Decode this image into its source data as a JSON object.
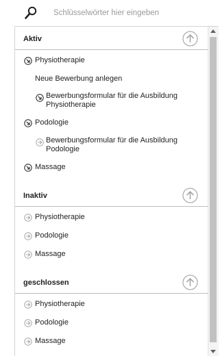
{
  "search": {
    "placeholder": "Schlüsselwörter hier eingeben"
  },
  "sections": {
    "aktiv": {
      "title": "Aktiv",
      "physio": "Physiotherapie",
      "neue_bewerbung": "Neue Bewerbung anlegen",
      "form_physio": "Bewerbungsformular für die Ausbildung Physiotherapie",
      "podo": "Podologie",
      "form_podo": "Bewerbungsformular für die Ausbildung Podologie",
      "massage": "Massage"
    },
    "inaktiv": {
      "title": "Inaktiv",
      "physio": "Physiotherapie",
      "podo": "Podologie",
      "massage": "Massage"
    },
    "geschlossen": {
      "title": "geschlossen",
      "physio": "Physiotherapie",
      "podo": "Podologie",
      "massage": "Massage"
    }
  },
  "icons": {
    "search": "magnifier-icon",
    "collapse": "circle-arrow-up-icon",
    "expanded": "circle-arrow-down-right-icon",
    "collapsed": "circle-arrow-right-icon"
  },
  "colors": {
    "icon_dark": "#1f1f1f",
    "icon_muted": "#a8a8a8",
    "divider": "#bdbdbd",
    "scroll_thumb": "#c1c1c1"
  }
}
